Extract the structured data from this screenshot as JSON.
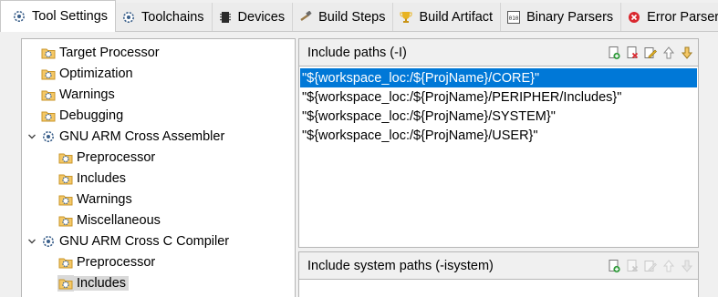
{
  "tabs": [
    {
      "label": "Tool Settings",
      "icon": "gear-icon",
      "active": true
    },
    {
      "label": "Toolchains",
      "icon": "gear-icon"
    },
    {
      "label": "Devices",
      "icon": "chip-icon"
    },
    {
      "label": "Build Steps",
      "icon": "hammer-icon"
    },
    {
      "label": "Build Artifact",
      "icon": "trophy-icon"
    },
    {
      "label": "Binary Parsers",
      "icon": "binary-icon"
    },
    {
      "label": "Error Parsers",
      "icon": "error-icon"
    }
  ],
  "tree": {
    "items": [
      {
        "label": "Target Processor",
        "icon": "settings-folder-icon"
      },
      {
        "label": "Optimization",
        "icon": "settings-folder-icon"
      },
      {
        "label": "Warnings",
        "icon": "settings-folder-icon"
      },
      {
        "label": "Debugging",
        "icon": "settings-folder-icon"
      },
      {
        "label": "GNU ARM Cross Assembler",
        "icon": "gear-icon",
        "expanded": true
      },
      {
        "label": "Preprocessor",
        "icon": "settings-folder-icon"
      },
      {
        "label": "Includes",
        "icon": "settings-folder-icon"
      },
      {
        "label": "Warnings",
        "icon": "settings-folder-icon"
      },
      {
        "label": "Miscellaneous",
        "icon": "settings-folder-icon"
      },
      {
        "label": "GNU ARM Cross C Compiler",
        "icon": "gear-icon",
        "expanded": true
      },
      {
        "label": "Preprocessor",
        "icon": "settings-folder-icon"
      },
      {
        "label": "Includes",
        "icon": "settings-folder-icon",
        "selected": true
      }
    ]
  },
  "include_paths": {
    "title": "Include paths (-I)",
    "tools": [
      "add-icon",
      "delete-icon",
      "edit-icon",
      "move-up-icon",
      "move-down-icon"
    ],
    "paths": [
      "\"${workspace_loc:/${ProjName}/CORE}\"",
      "\"${workspace_loc:/${ProjName}/PERIPHER/Includes}\"",
      "\"${workspace_loc:/${ProjName}/SYSTEM}\"",
      "\"${workspace_loc:/${ProjName}/USER}\""
    ],
    "selected_index": 0
  },
  "system_paths": {
    "title": "Include system paths (-isystem)",
    "tools": [
      "add-icon",
      "delete-icon",
      "edit-icon",
      "move-up-icon",
      "move-down-icon"
    ]
  },
  "colors": {
    "selection": "#0078d7",
    "tree_selection": "#d9d9d9",
    "panel_header": "#f0f0f0"
  }
}
